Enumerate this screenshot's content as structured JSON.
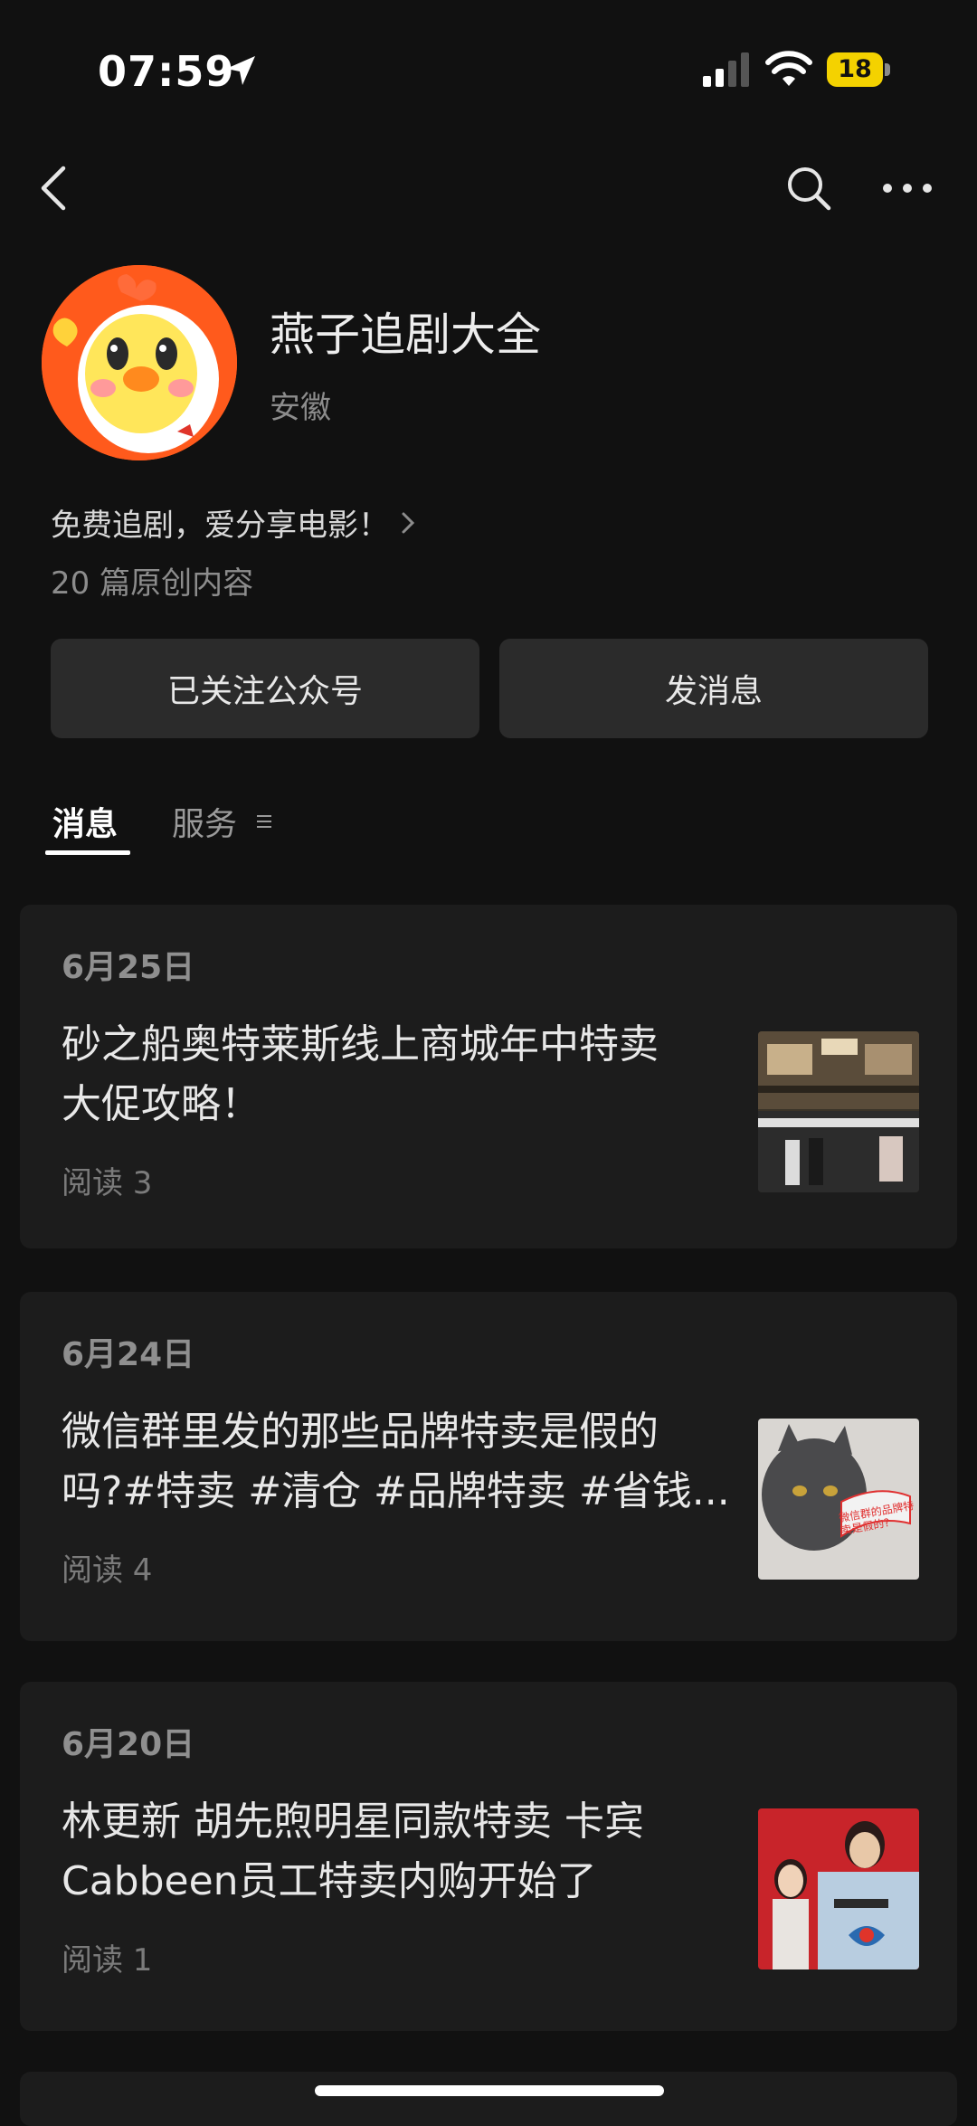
{
  "status_bar": {
    "time": "07:59",
    "battery": "18"
  },
  "profile": {
    "name": "燕子追剧大全",
    "region": "安徽",
    "bio": "免费追剧，爱分享电影！",
    "article_count": "20 篇原创内容"
  },
  "buttons": {
    "follow": "已关注公众号",
    "message": "发消息"
  },
  "tabs": {
    "messages": "消息",
    "services": "服务"
  },
  "articles": [
    {
      "date": "6月25日",
      "title_line1": "砂之船奥特莱斯线上商城年中特卖",
      "title_line2": "大促攻略！",
      "reads": "阅读 3"
    },
    {
      "date": "6月24日",
      "title_line1": "微信群里发的那些品牌特卖是假的",
      "title_line2": "吗?#特卖 #清仓 #品牌特卖 #省钱...",
      "reads": "阅读 4",
      "thumb_caption": "微信群的品牌特卖是假的?"
    },
    {
      "date": "6月20日",
      "title_line1": "林更新 胡先煦明星同款特卖 卡宾",
      "title_line2": "Cabbeen员工特卖内购开始了",
      "reads": "阅读 1"
    }
  ]
}
